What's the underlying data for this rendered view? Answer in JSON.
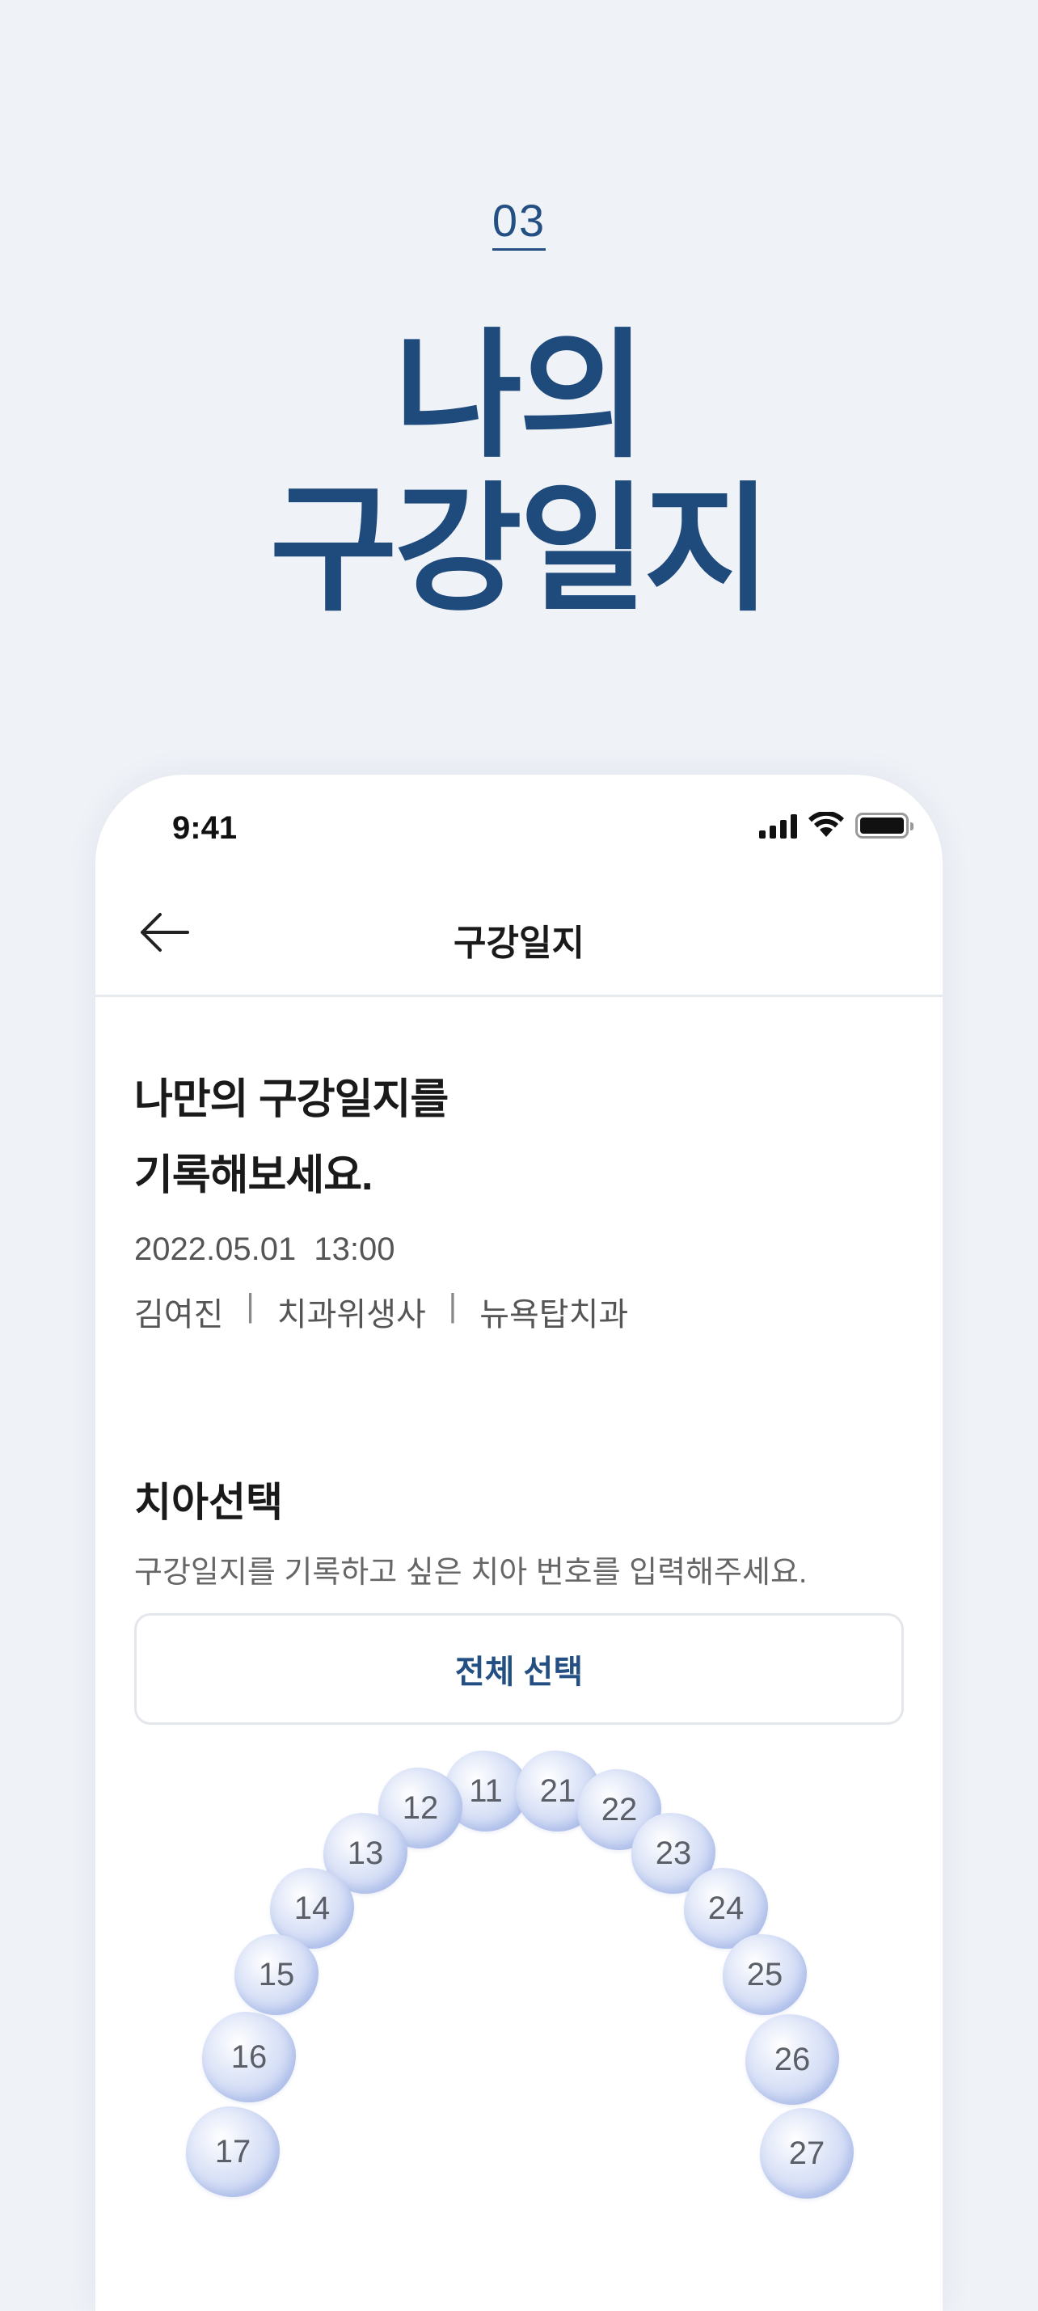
{
  "intro_section": {
    "step_number": "03",
    "title_line1": "나의",
    "title_line2": "구강일지"
  },
  "status_bar": {
    "time": "9:41"
  },
  "nav": {
    "title": "구강일지"
  },
  "content": {
    "heading_line1": "나만의 구강일지를",
    "heading_line2": "기록해보세요.",
    "datetime": "2022.05.01  13:00",
    "author_name": "김여진",
    "separator": "|",
    "author_role": "치과위생사",
    "clinic_name": "뉴욕탑치과"
  },
  "tooth_selection": {
    "title": "치아선택",
    "description": "구강일지를 기록하고 싶은 치아 번호를 입력해주세요.",
    "select_all_label": "전체 선택",
    "teeth": [
      "11",
      "12",
      "13",
      "14",
      "15",
      "16",
      "17",
      "21",
      "22",
      "23",
      "24",
      "25",
      "26",
      "27"
    ]
  },
  "colors": {
    "primary": "#1f4a7c",
    "background": "#eff2f7",
    "tooth_tint": "#bccaf0"
  }
}
